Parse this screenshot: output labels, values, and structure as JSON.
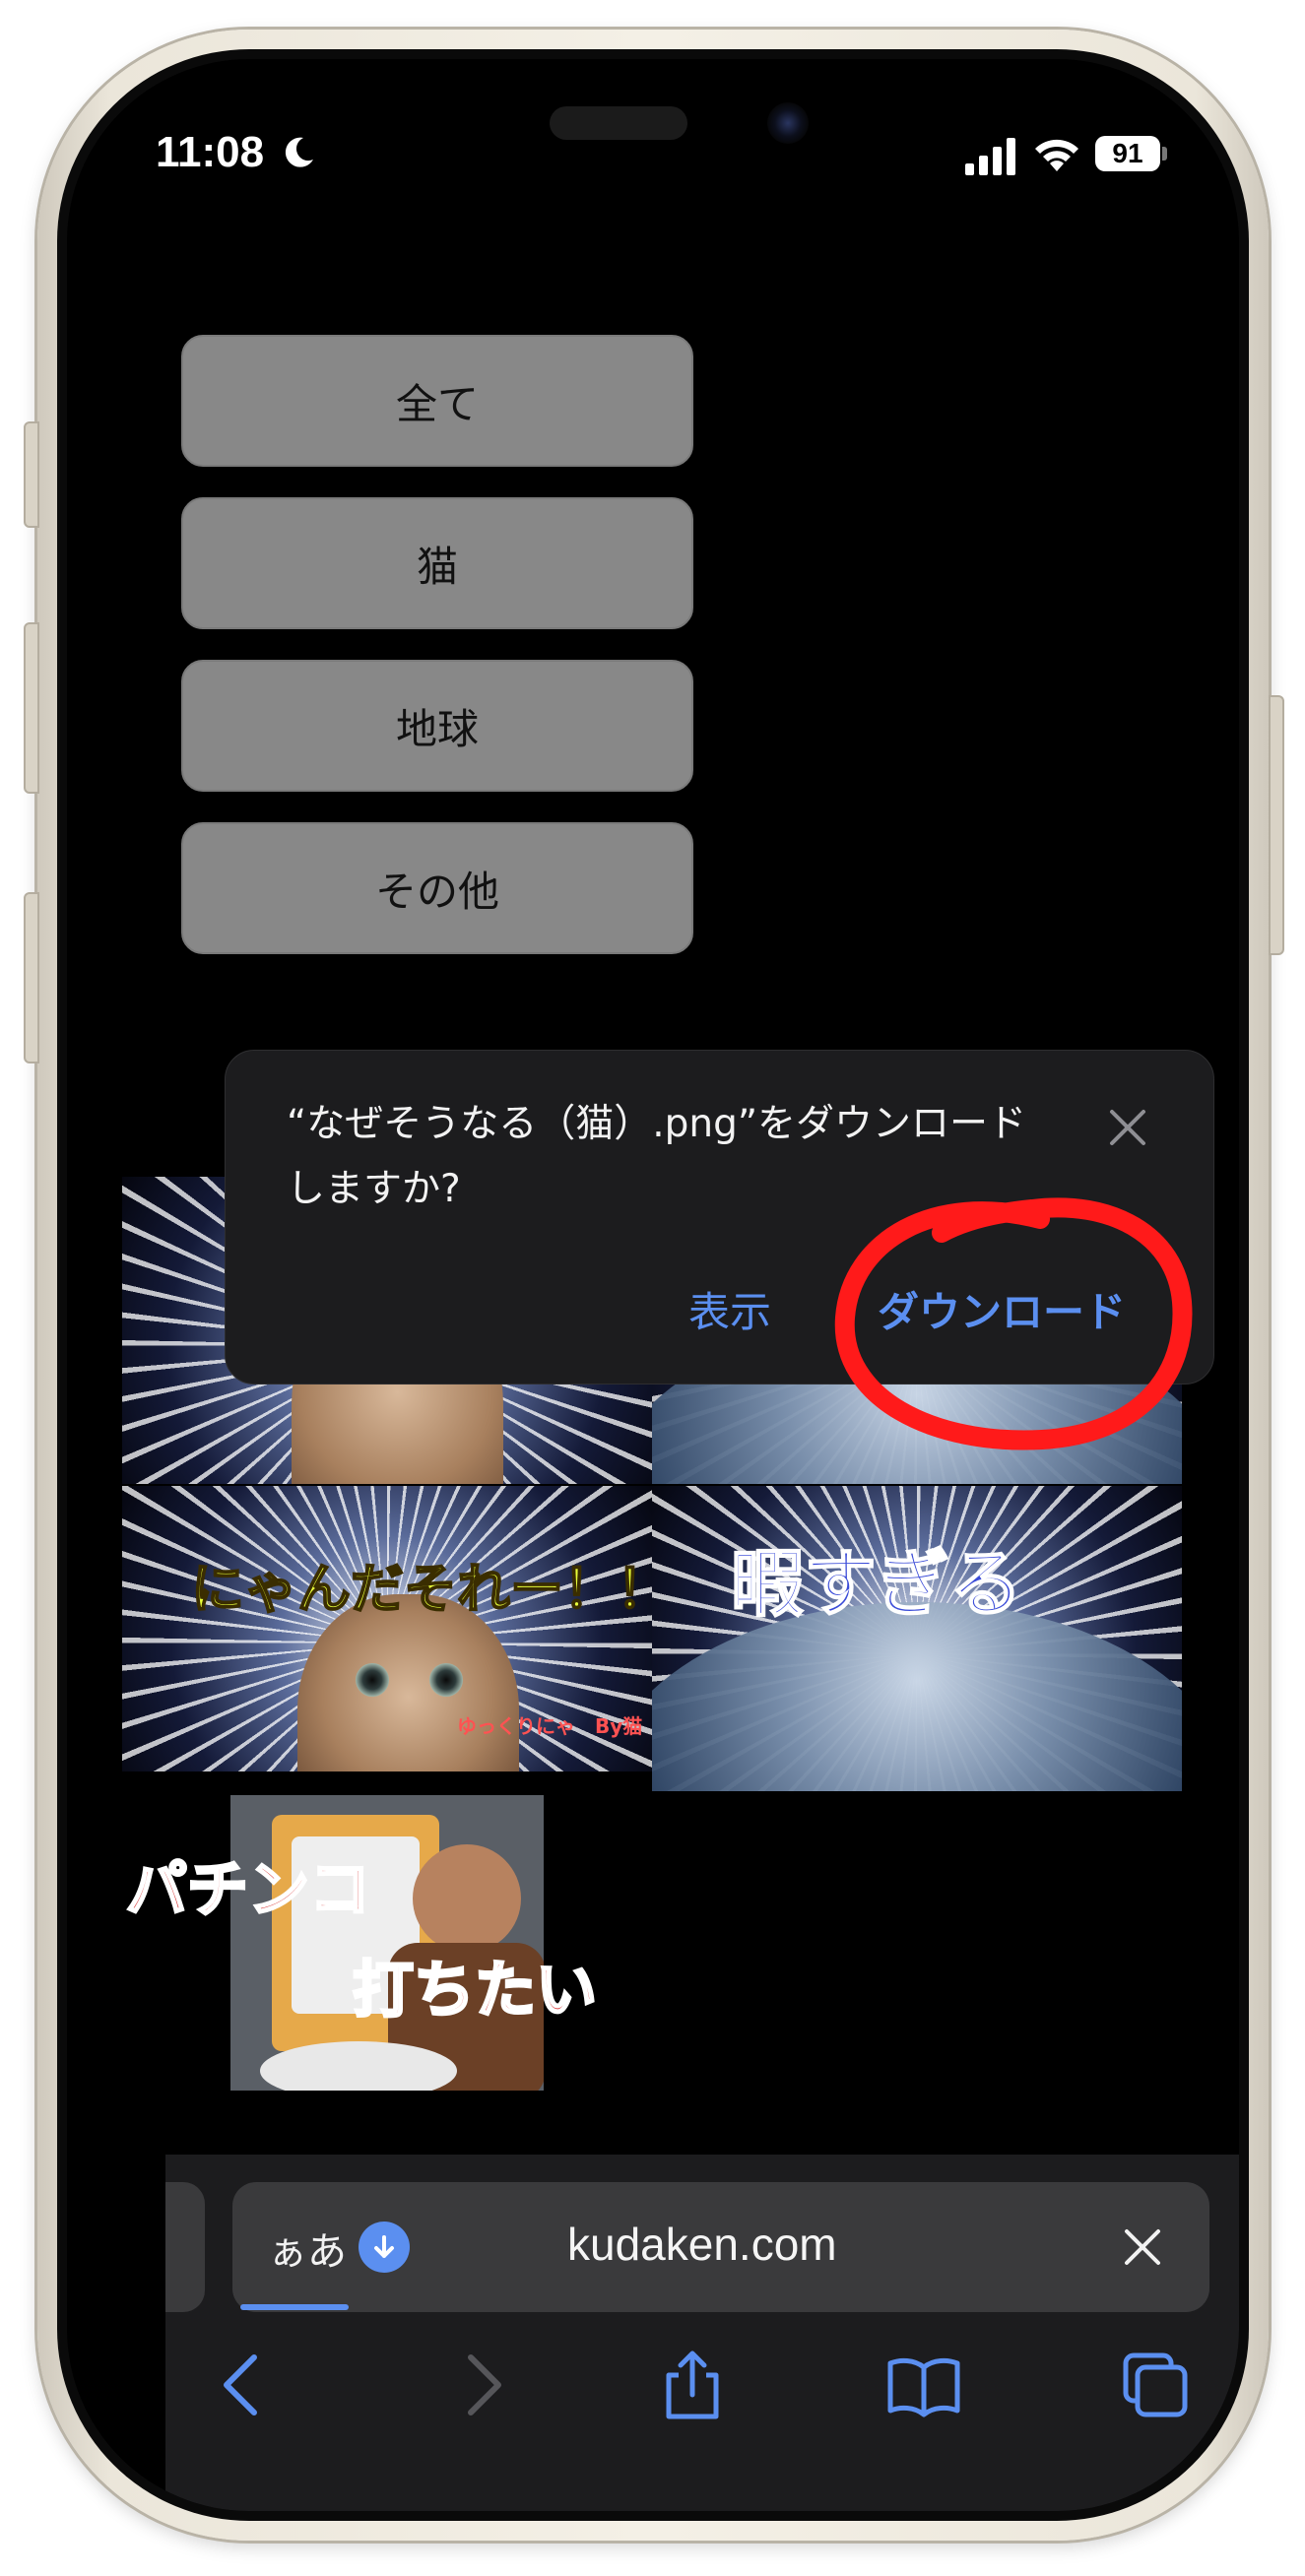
{
  "status_bar": {
    "time": "11:08",
    "battery": "91"
  },
  "categories": [
    {
      "label": "全て"
    },
    {
      "label": "猫"
    },
    {
      "label": "地球"
    },
    {
      "label": "その他"
    }
  ],
  "thumbnails": {
    "cat_caption": "にゃんだそれー！！",
    "cat_footer": "ゆっくりにゃ　By猫",
    "earth_caption": "暇すぎる",
    "pachinko_line1": "パチンコ",
    "pachinko_line2": "打ちたい"
  },
  "download_dialog": {
    "message": "“なぜそうなる（猫）.png”をダウンロードしますか?",
    "view_label": "表示",
    "download_label": "ダウンロード"
  },
  "address_bar": {
    "reader_label": "ぁあ",
    "url": "kudaken.com"
  },
  "colors": {
    "accent": "#5b8ff0",
    "button_gray": "#888888",
    "annotation_red": "#ff1a1a"
  }
}
